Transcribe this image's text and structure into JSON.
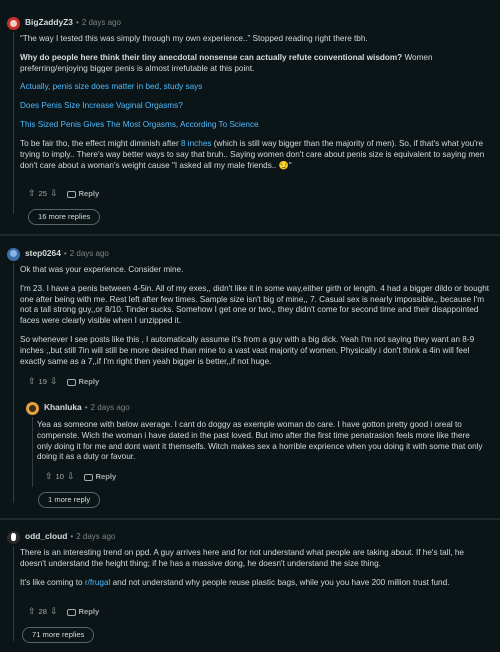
{
  "comments": [
    {
      "username": "BigZaddyZ3",
      "time": "2 days ago",
      "paragraphs": [
        "“The way I tested this was simply through my own experience..” Stopped reading right there tbh.",
        "Why do people here think their tiny anecdotal nonsense can actually refute conventional wisdom?",
        "Women preferring/enjoying bigger penis is almost irrefutable at this point.",
        "Actually, penis size does matter in bed, study says",
        "Does Penis Size Increase Vaginal Orgasms?",
        "This Sized Penis Gives The Most Orgasms, According To Science",
        "To be fair tho, the effect might diminish after",
        "8 inches",
        "(which is still way bigger than the majority of men). So, if that's what you're trying to imply.. There's way better ways to say that bruh.. Saying women don't care about penis size is equivalent to saying men don't care about a woman's weight cause \"I asked all my male friends.. 😏\""
      ],
      "votes": "25",
      "reply_label": "Reply",
      "more_replies": "16 more replies"
    },
    {
      "username": "step0264",
      "time": "2 days ago",
      "paragraphs": [
        "Ok that was your experience. Consider mine.",
        "I'm 23. I have a penis between 4-5in. All of my exes,, didn't like it in some way,either girth or length. 4 had a bigger dildo or bought one after being with me. Rest left after few times. Sample size isn't big of mine,, 7. Casual sex is nearly impossible,, because I'm not a tall strong guy,,or 8/10. Tinder sucks. Somehow I get one or two,, they didn't come for second time and their disappointed faces were clearly visible when I unzipped it.",
        "So whenever I see posts like this , I automatically assume it's from a guy with a big dick. Yeah I'm not saying they want an 8-9 inches ,,but still 7in will still be more desired than mine to a vast vast majority of women. Physically i don't think a 4in will feel exactly same as a 7,,if I'm right then yeah bigger is better,,if not huge."
      ],
      "votes": "19",
      "reply_label": "Reply"
    },
    {
      "username": "Khanluka",
      "time": "2 days ago",
      "paragraphs": [
        "Yea as someone with below average. I cant do doggy as exemple woman do care. I have gotton pretty good i oreal to compenste. Wich the woman i have dated in the past loved. But imo after the first time penatrasion feels more like there only doing it for me and dont want it themselfs. Witch makes sex a horrible exprience when you doing it with some that only doing it as a duty or favour."
      ],
      "votes": "10",
      "reply_label": "Reply",
      "more_replies": "1 more reply"
    },
    {
      "username": "odd_cloud",
      "time": "2 days ago",
      "paragraphs": [
        "There is an interesting trend on ppd. A guy arrives here and for not understand what people are taking about. If he's tall, he doesn't understand the height thing; if he has a massive dong, he doesn't understand the size thing.",
        "It's like coming to",
        "r/frugal",
        "and not understand why people reuse plastic bags, while you you have 200 million trust fund."
      ],
      "votes": "28",
      "reply_label": "Reply",
      "more_replies": "71 more replies"
    }
  ]
}
